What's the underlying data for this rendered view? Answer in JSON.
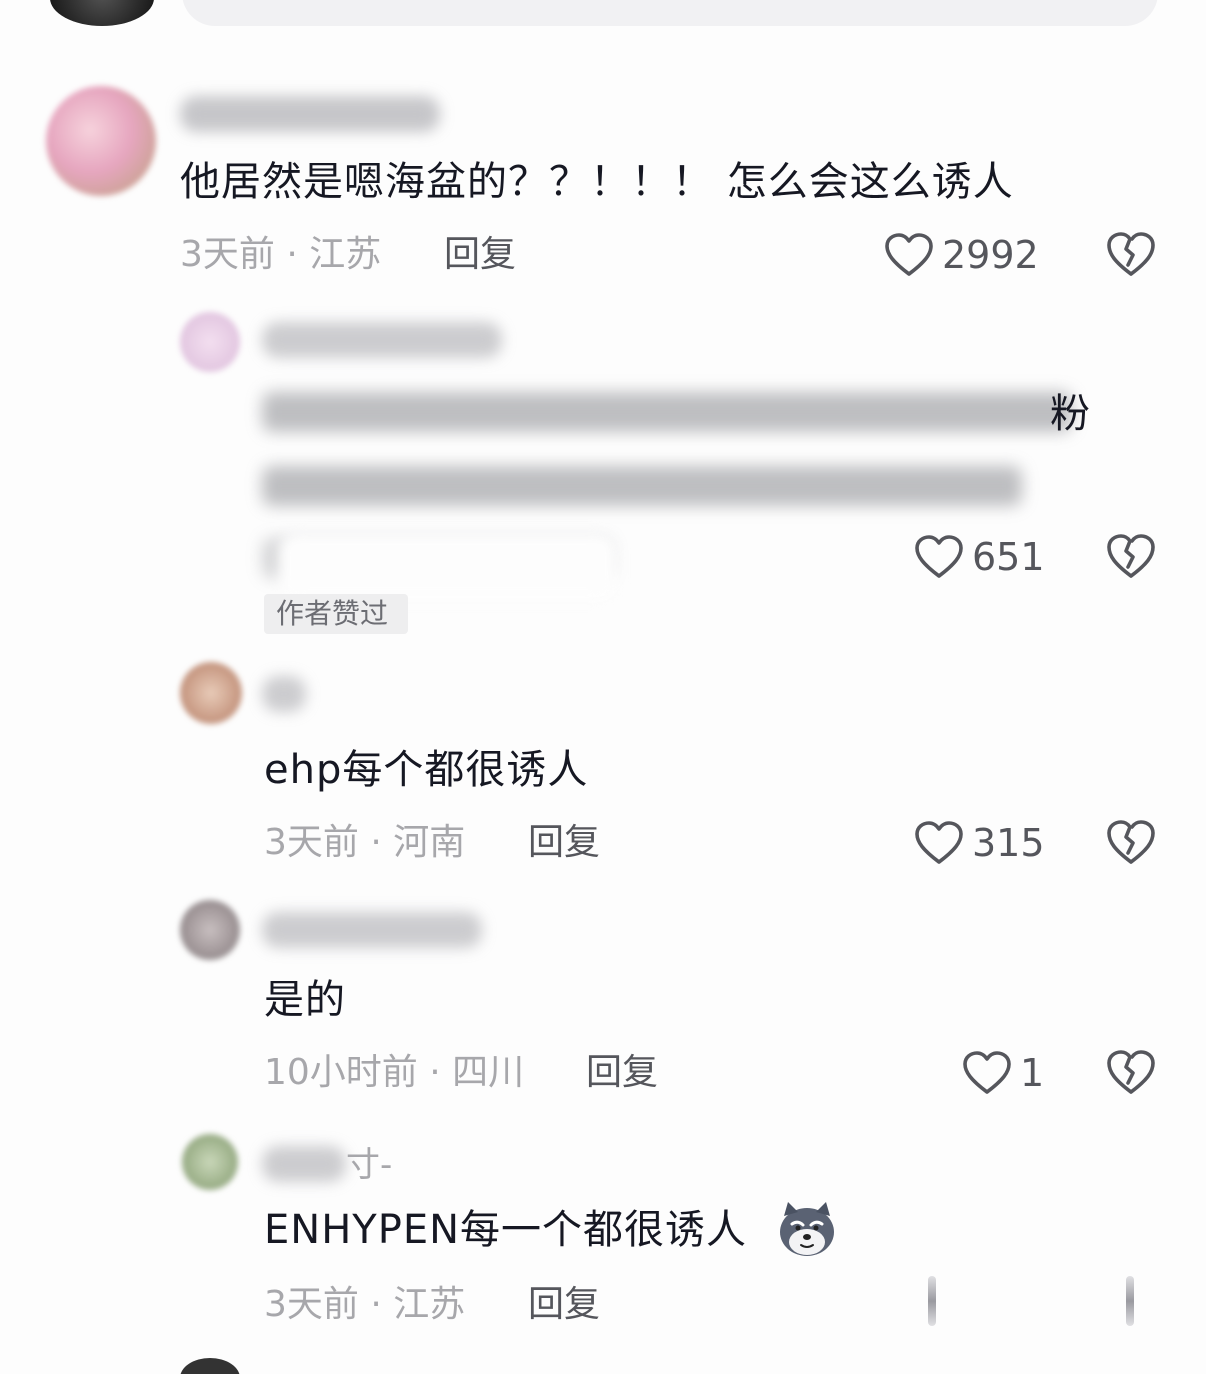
{
  "comments": [
    {
      "text": "他居然是嗯海盆的？？！！！ 怎么会这么诱人",
      "meta": "3天前 · 江苏",
      "reply_label": "回复",
      "likes": "2992"
    },
    {
      "author_tag": "作者赞过",
      "likes": "651",
      "visible_fragment": "粉"
    },
    {
      "text": "ehp每个都很诱人",
      "meta": "3天前 · 河南",
      "reply_label": "回复",
      "likes": "315"
    },
    {
      "text": "是的",
      "meta": "10小时前 · 四川",
      "reply_label": "回复",
      "likes": "1"
    },
    {
      "username_fragment": "寸-",
      "text": "ENHYPEN每一个都很诱人",
      "meta": "3天前 · 江苏",
      "reply_label": "回复"
    }
  ],
  "icons": {
    "like": "heart-outline-icon",
    "dislike": "broken-heart-icon",
    "emoji": "wolf-emoji-icon"
  },
  "colors": {
    "text": "#161823",
    "meta": "#a7a7ab",
    "action": "#55565c"
  }
}
